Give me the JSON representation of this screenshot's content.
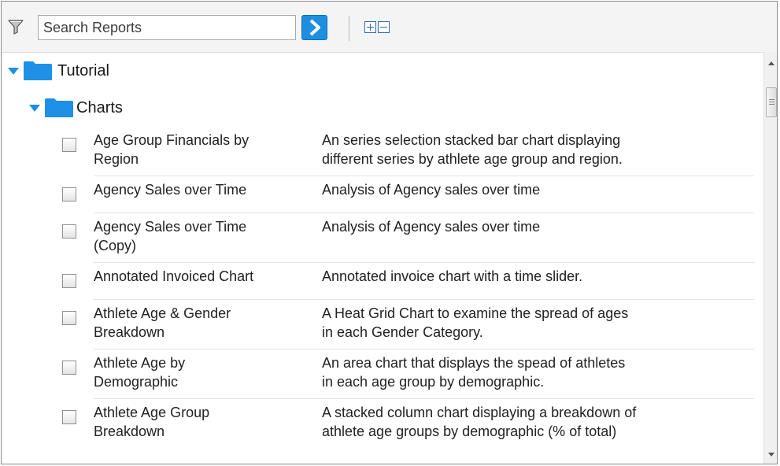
{
  "toolbar": {
    "search_placeholder": "Search Reports",
    "go_icon": "chevron-right-icon",
    "expand_all_icon": "expand-all-icon",
    "collapse_all_icon": "collapse-all-icon",
    "accent_color": "#1e8fe0"
  },
  "tree": {
    "root_folder": {
      "label": "Tutorial",
      "icon": "folder-icon",
      "expanded": true
    },
    "sub_folder": {
      "label": "Charts",
      "icon": "folder-icon",
      "expanded": true
    },
    "reports": [
      {
        "name": "Age Group Financials by\nRegion",
        "description": "An series selection stacked bar chart displaying\ndifferent series by athlete age group and region.",
        "checked": false
      },
      {
        "name": "Agency Sales over Time",
        "description": "Analysis of Agency sales over time",
        "checked": false
      },
      {
        "name": "Agency Sales over Time\n(Copy)",
        "description": "Analysis of Agency sales over time",
        "checked": false
      },
      {
        "name": "Annotated Invoiced Chart",
        "description": "Annotated invoice chart with a time slider.",
        "checked": false
      },
      {
        "name": "Athlete Age & Gender\nBreakdown",
        "description": "A Heat Grid Chart to examine the spread of ages\nin each Gender Category.",
        "checked": false
      },
      {
        "name": "Athlete Age by\nDemographic",
        "description": "An area chart that displays the spead of athletes\nin each age group by demographic.",
        "checked": false
      },
      {
        "name": "Athlete Age Group\nBreakdown",
        "description": "A stacked column chart displaying a breakdown of\nathlete age groups by demographic (% of total)",
        "checked": false
      }
    ]
  },
  "folder_color": "#1e90e6"
}
